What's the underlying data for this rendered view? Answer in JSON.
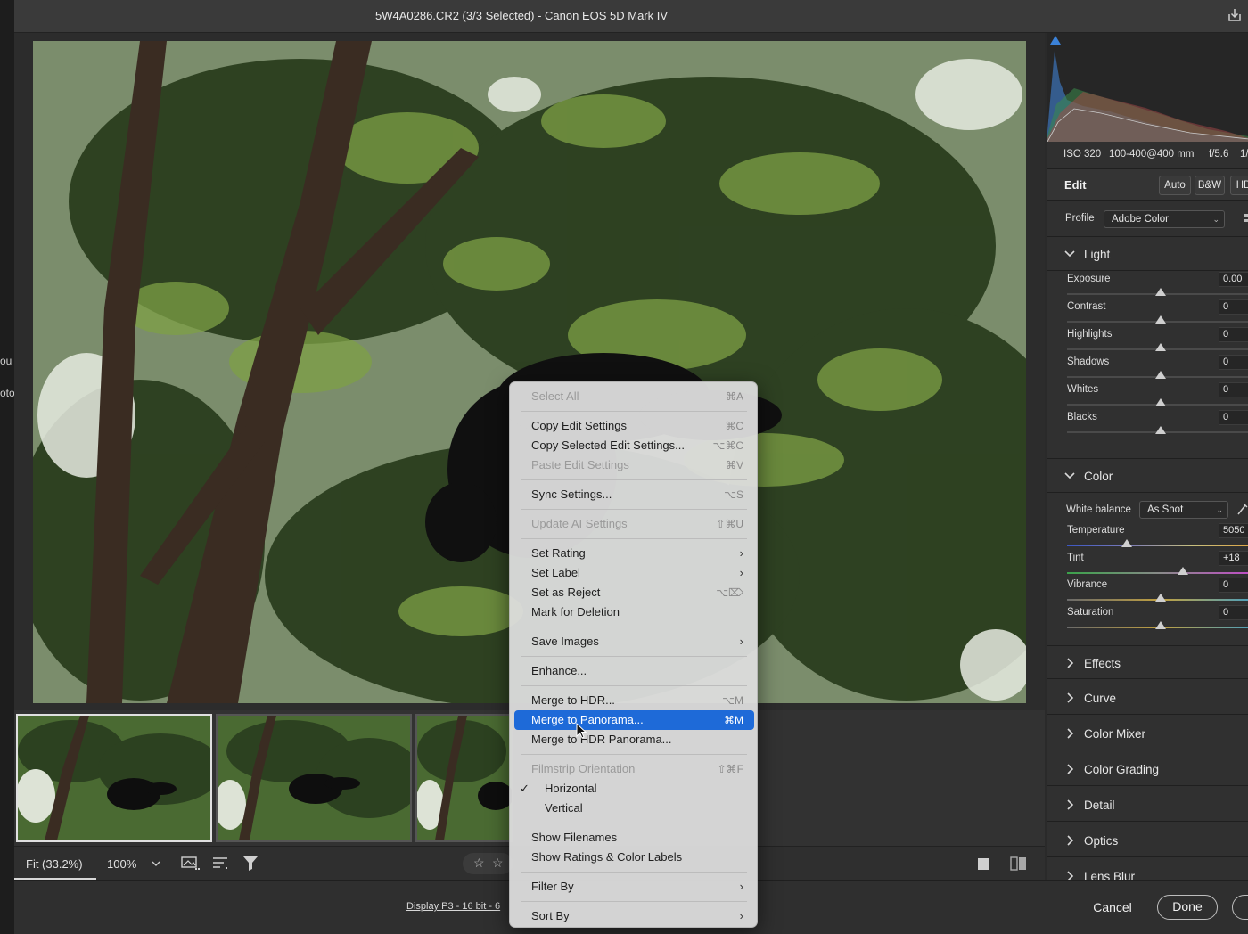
{
  "window": {
    "title": "5W4A0286.CR2 (3/3 Selected)  -  Canon EOS 5D Mark IV",
    "left_fragments": [
      "ou",
      "oto"
    ]
  },
  "colors": {
    "menu_highlight": "#1e6ad8",
    "panel_bg": "#303030",
    "photo_foliage": "#3d5a2a"
  },
  "filmstrip": {
    "thumbnails": [
      {
        "selected": true
      },
      {
        "selected": false
      },
      {
        "selected": false
      }
    ]
  },
  "toolbar": {
    "fit_label": "Fit (33.2%)",
    "zoom_label": "100%",
    "icons": [
      "thumbnail-view-icon",
      "sort-icon",
      "filter-icon",
      "star-icon",
      "compare-view-icon",
      "split-view-icon"
    ]
  },
  "status": {
    "display_info": "Display P3 - 16 bit - 6",
    "cancel_label": "Cancel",
    "done_label": "Done"
  },
  "right_panel": {
    "exif": {
      "iso": "ISO 320",
      "lens": "100-400@400 mm",
      "aperture": "f/5.6",
      "shutter": "1/"
    },
    "edit_label": "Edit",
    "auto_label": "Auto",
    "bw_label": "B&W",
    "hdr_label": "HD",
    "profile_label": "Profile",
    "profile_value": "Adobe Color",
    "light": {
      "title": "Light",
      "sliders": [
        {
          "label": "Exposure",
          "value": "0.00",
          "pos": 0.5
        },
        {
          "label": "Contrast",
          "value": "0",
          "pos": 0.5
        },
        {
          "label": "Highlights",
          "value": "0",
          "pos": 0.5
        },
        {
          "label": "Shadows",
          "value": "0",
          "pos": 0.5
        },
        {
          "label": "Whites",
          "value": "0",
          "pos": 0.5
        },
        {
          "label": "Blacks",
          "value": "0",
          "pos": 0.5
        }
      ]
    },
    "color": {
      "title": "Color",
      "wb_label": "White balance",
      "wb_value": "As Shot",
      "sliders": [
        {
          "label": "Temperature",
          "value": "5050",
          "pos": 0.32
        },
        {
          "label": "Tint",
          "value": "+18",
          "pos": 0.62
        },
        {
          "label": "Vibrance",
          "value": "0",
          "pos": 0.5
        },
        {
          "label": "Saturation",
          "value": "0",
          "pos": 0.5
        }
      ]
    },
    "sections": [
      "Effects",
      "Curve",
      "Color Mixer",
      "Color Grading",
      "Detail",
      "Optics",
      "Lens Blur"
    ]
  },
  "context_menu": {
    "items": [
      {
        "label": "Select All",
        "shortcut": "⌘A",
        "disabled": true
      },
      {
        "sep": true
      },
      {
        "label": "Copy Edit Settings",
        "shortcut": "⌘C"
      },
      {
        "label": "Copy Selected Edit Settings...",
        "shortcut": "⌥⌘C"
      },
      {
        "label": "Paste Edit Settings",
        "shortcut": "⌘V",
        "disabled": true
      },
      {
        "sep": true
      },
      {
        "label": "Sync Settings...",
        "shortcut": "⌥S"
      },
      {
        "sep": true
      },
      {
        "label": "Update AI Settings",
        "shortcut": "⇧⌘U",
        "disabled": true
      },
      {
        "sep": true
      },
      {
        "label": "Set Rating",
        "submenu": true
      },
      {
        "label": "Set Label",
        "submenu": true
      },
      {
        "label": "Set as Reject",
        "shortcut": "⌥⌦"
      },
      {
        "label": "Mark for Deletion"
      },
      {
        "sep": true
      },
      {
        "label": "Save Images",
        "submenu": true
      },
      {
        "sep": true
      },
      {
        "label": "Enhance..."
      },
      {
        "sep": true
      },
      {
        "label": "Merge to HDR...",
        "shortcut": "⌥M"
      },
      {
        "label": "Merge to Panorama...",
        "shortcut": "⌘M",
        "highlight": true
      },
      {
        "label": "Merge to HDR Panorama..."
      },
      {
        "sep": true
      },
      {
        "label": "Filmstrip Orientation",
        "shortcut": "⇧⌘F",
        "disabled": true
      },
      {
        "label": "Horizontal",
        "checked": true,
        "indent": true
      },
      {
        "label": "Vertical",
        "indent": true
      },
      {
        "sep": true
      },
      {
        "label": "Show Filenames"
      },
      {
        "label": "Show Ratings & Color Labels"
      },
      {
        "sep": true
      },
      {
        "label": "Filter By",
        "submenu": true
      },
      {
        "sep": true
      },
      {
        "label": "Sort By",
        "submenu": true
      }
    ]
  }
}
